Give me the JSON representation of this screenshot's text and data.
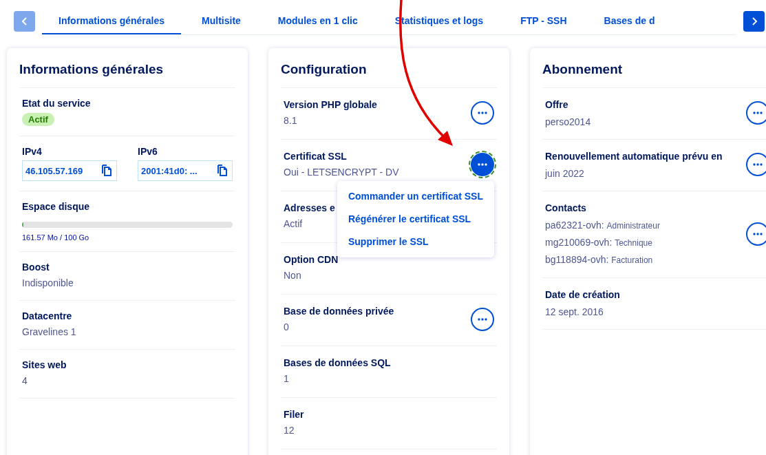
{
  "tabs": [
    {
      "label": "Informations générales",
      "selected": true
    },
    {
      "label": "Multisite",
      "selected": false
    },
    {
      "label": "Modules en 1 clic",
      "selected": false
    },
    {
      "label": "Statistiques et logs",
      "selected": false
    },
    {
      "label": "FTP - SSH",
      "selected": false
    },
    {
      "label": "Bases de d",
      "selected": false
    }
  ],
  "general": {
    "title": "Informations générales",
    "service": {
      "label": "Etat du service",
      "badge": "Actif"
    },
    "ips": [
      {
        "label": "IPv4",
        "value": "46.105.57.169"
      },
      {
        "label": "IPv6",
        "value": "2001:41d0: ..."
      }
    ],
    "disk": {
      "label": "Espace disque",
      "level": 0.005,
      "reading": "161.57 Mo / 100 Go"
    },
    "rows": [
      {
        "label": "Boost",
        "value": "Indisponible"
      },
      {
        "label": "Datacentre",
        "value": "Gravelines 1"
      },
      {
        "label": "Sites web",
        "value": "4"
      }
    ]
  },
  "configuration": {
    "title": "Configuration",
    "rows": [
      {
        "label": "Version PHP globale",
        "value": "8.1",
        "menu_button": true,
        "active": false
      },
      {
        "label": "Certificat SSL",
        "value": "Oui - LETSENCRYPT - DV",
        "menu_button": true,
        "active": true,
        "menu": [
          "Commander un certificat SSL",
          "Régénérer le certificat SSL",
          "Supprimer le SSL"
        ]
      },
      {
        "label": "Adresses e",
        "value": "Actif",
        "menu_button": false
      },
      {
        "label": "Option CDN",
        "value": "Non",
        "menu_button": false
      },
      {
        "label": "Base de données privée",
        "value": "0",
        "menu_button": true,
        "active": false
      },
      {
        "label": "Bases de données SQL",
        "value": "1",
        "menu_button": false
      },
      {
        "label": "Filer",
        "value": "12",
        "menu_button": false
      }
    ]
  },
  "subscription": {
    "title": "Abonnement",
    "rows": [
      {
        "label": "Offre",
        "value": "perso2014",
        "menu_button": true
      },
      {
        "label": "Renouvellement automatique prévu en",
        "value": "juin 2022",
        "menu_button": true
      },
      {
        "label": "Contacts",
        "contacts": [
          {
            "id": "pa62321-ovh:",
            "role": "Administrateur"
          },
          {
            "id": "mg210069-ovh:",
            "role": "Technique"
          },
          {
            "id": "bg118894-ovh:",
            "role": "Facturation"
          }
        ],
        "menu_button": true
      },
      {
        "label": "Date de création",
        "value": "12 sept. 2016",
        "menu_button": false
      }
    ]
  }
}
